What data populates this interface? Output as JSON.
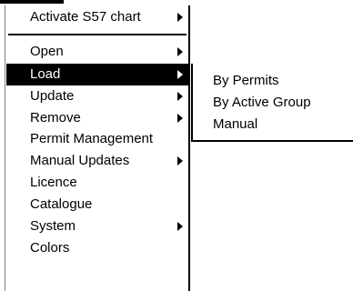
{
  "menu": {
    "items": [
      {
        "label": "Activate S57 chart",
        "submenu": true,
        "selected": false
      },
      {
        "label": "Open",
        "submenu": true,
        "selected": false
      },
      {
        "label": "Load",
        "submenu": true,
        "selected": true
      },
      {
        "label": "Update",
        "submenu": true,
        "selected": false
      },
      {
        "label": "Remove",
        "submenu": true,
        "selected": false
      },
      {
        "label": "Permit Management",
        "submenu": false,
        "selected": false
      },
      {
        "label": "Manual Updates",
        "submenu": true,
        "selected": false
      },
      {
        "label": "Licence",
        "submenu": false,
        "selected": false
      },
      {
        "label": "Catalogue",
        "submenu": false,
        "selected": false
      },
      {
        "label": "System",
        "submenu": true,
        "selected": false
      },
      {
        "label": "Colors",
        "submenu": false,
        "selected": false
      }
    ]
  },
  "submenu": {
    "items": [
      {
        "label": "By Permits"
      },
      {
        "label": "By Active Group"
      },
      {
        "label": "Manual"
      }
    ]
  },
  "colors": {
    "selection_background": "#000000",
    "selection_text": "#ffffff",
    "menu_background": "#ffffff"
  }
}
